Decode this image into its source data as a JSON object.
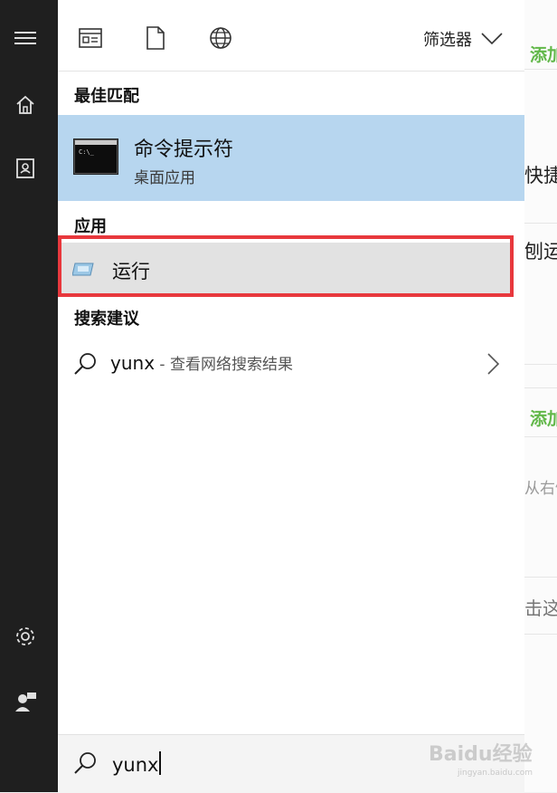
{
  "toolbar": {
    "filter_label": "筛选器",
    "icons": [
      "documents-icon",
      "file-icon",
      "web-icon",
      "chevron-down-icon"
    ]
  },
  "sections": {
    "best_match": "最佳匹配",
    "apps": "应用",
    "suggestions": "搜索建议"
  },
  "best_match": {
    "title": "命令提示符",
    "subtitle": "桌面应用",
    "icon_text": "C:\\_"
  },
  "apps": [
    {
      "label": "运行"
    }
  ],
  "suggestion": {
    "query": "yunx",
    "rest": " - 查看网络搜索结果"
  },
  "search": {
    "value": "yunx"
  },
  "background": {
    "green1": "添加",
    "dark1": "快捷",
    "dark2": "刨运",
    "green2": "添加",
    "gray1": "从右侧",
    "gray2": "击这"
  },
  "watermark": {
    "text": "Baidu经验",
    "sub": "jingyan.baidu.com"
  },
  "colors": {
    "accent_highlight": "#b7d6ef",
    "annotation_red": "#e8383d",
    "rail_bg": "#1f1f1f",
    "green": "#62b84a"
  }
}
